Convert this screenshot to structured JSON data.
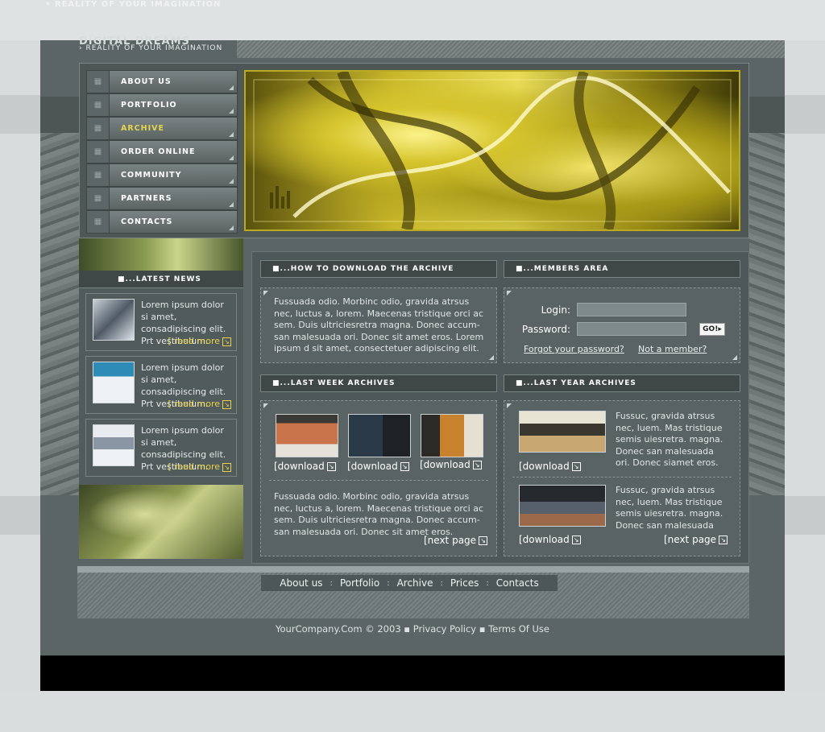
{
  "ghost_brand": "• REALITY OF YOUR IMAGINATION",
  "brand": {
    "name": "DIGITAL DREAMS",
    "tagline": "› REALITY OF YOUR IMAGINATION"
  },
  "nav": {
    "items": [
      {
        "label": "ABOUT US",
        "active": false
      },
      {
        "label": "PORTFOLIO",
        "active": false
      },
      {
        "label": "ARCHIVE",
        "active": true
      },
      {
        "label": "ORDER ONLINE",
        "active": false
      },
      {
        "label": "COMMUNITY",
        "active": false
      },
      {
        "label": "PARTNERS",
        "active": false
      },
      {
        "label": "CONTACTS",
        "active": false
      }
    ]
  },
  "news": {
    "heading": "■...LATEST NEWS",
    "items": [
      {
        "text": "Lorem ipsum dolor si amet, consadipiscing elit. Prt vestibulum.",
        "more": "[ read more"
      },
      {
        "text": "Lorem ipsum dolor si amet, consadipiscing elit. Prt vestibulum.",
        "more": "[ read more"
      },
      {
        "text": "Lorem ipsum dolor si amet, consadipiscing elit. Prt vestibulum.",
        "more": "[ read more"
      }
    ]
  },
  "how_to": {
    "heading": "■...HOW TO DOWNLOAD THE ARCHIVE",
    "text": "Fussuada odio. Morbinc odio, gravida atrsus nec, luctus a, lorem. Maecenas tristique orci ac sem. Duis ultriciesretra magna. Donec accum-san malesuada ori. Donec sit amet eros. Lorem ipsum d sit amet, consectetuer adipiscing elit."
  },
  "members": {
    "heading": "■...MEMBERS AREA",
    "login_label": "Login:",
    "password_label": "Password:",
    "go_label": "GO!",
    "forgot_link": "Forgot your password?",
    "not_member_link": "Not a member?"
  },
  "last_week": {
    "heading": "■...LAST WEEK ARCHIVES",
    "downloads": [
      "[download",
      "[download",
      "[download"
    ],
    "text": "Fussuada odio. Morbinc odio, gravida atrsus nec, luctus a, lorem. Maecenas tristique orci ac sem. Duis ultriciesretra magna. Donec accum-san malesuada ori. Donec sit amet eros.",
    "next": "[next page"
  },
  "last_year": {
    "heading": "■...LAST YEAR ARCHIVES",
    "items": [
      {
        "text": "Fussuc, gravida atrsus nec, luem. Mas tristique semis uiesretra. magna. Donec san malesuada ori. Donec siamet eros.",
        "download": "[download"
      },
      {
        "text": "Fussuc, gravida atrsus nec, luem. Mas tristique semis uiesretra. magna. Donec san malesuada",
        "download": "[download"
      }
    ],
    "next": "[next page"
  },
  "footer": {
    "links": [
      "About us",
      "Portfolio",
      "Archive",
      "Prices",
      "Contacts"
    ],
    "separator": ":",
    "copyright": "YourCompany.Com © 2003 ▪ Privacy Policy ▪ Terms Of Use"
  },
  "colors": {
    "accent": "#e4d44e",
    "panel": "#5a6363",
    "header": "#3f4747"
  }
}
